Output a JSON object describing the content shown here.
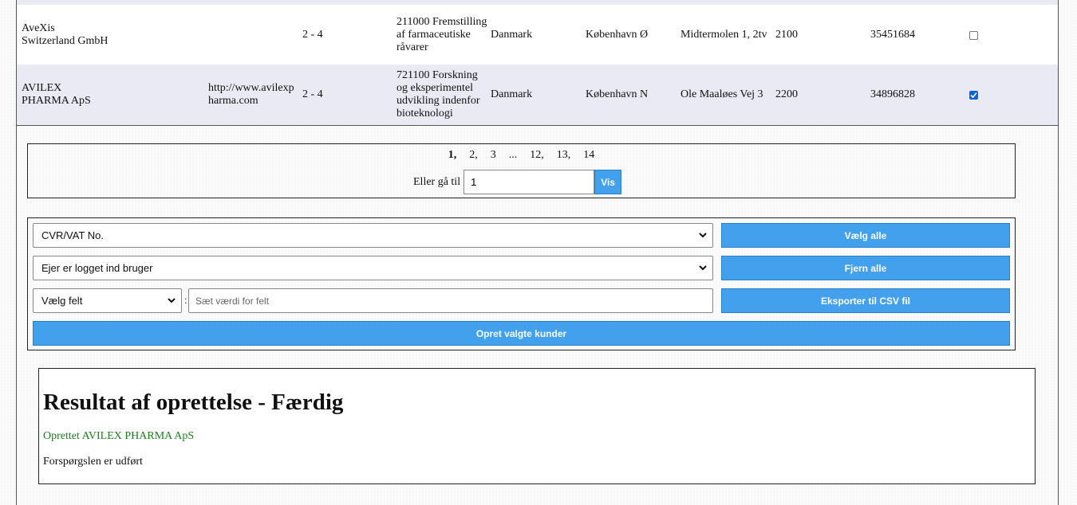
{
  "rows": [
    {
      "name": "AveXis Switzerland GmbH",
      "website": "",
      "employees": "2 - 4",
      "industry": "211000 Fremstilling af farmaceutiske råvarer",
      "country": "Danmark",
      "city": "København Ø",
      "address": "Midtermolen 1, 2tv",
      "zip": "2100",
      "cvr": "35451684",
      "checked": false
    },
    {
      "name": "AVILEX PHARMA ApS",
      "website": "http://www.avilexpharma.com",
      "employees": "2 - 4",
      "industry": "721100 Forskning og eksperimentel udvikling indenfor bioteknologi",
      "country": "Danmark",
      "city": "København N",
      "address": "Ole Maaløes Vej 3",
      "zip": "2200",
      "cvr": "34896828",
      "checked": true
    }
  ],
  "pagination": {
    "pages": [
      "1,",
      "2,",
      "3",
      "...",
      "12,",
      "13,",
      "14"
    ],
    "current": "1,",
    "goto_label": "Eller gå til",
    "goto_value": "1",
    "vis_label": "Vis"
  },
  "form": {
    "field_select": "CVR/VAT No.",
    "owner_select": "Ejer er logget ind bruger",
    "felt_select": "Vælg felt",
    "colon": ":",
    "value_placeholder": "Sæt værdi for felt",
    "select_all_label": "Vælg alle",
    "remove_all_label": "Fjern alle",
    "export_label": "Eksporter til CSV fil",
    "create_label": "Opret valgte kunder"
  },
  "result": {
    "title": "Resultat af oprettelse - Færdig",
    "created_text": "Oprettet AVILEX PHARMA ApS",
    "done_text": "Forspørgslen er udført"
  },
  "colors": {
    "button_blue": "#42a0ec",
    "row_alt": "#e9eaf3",
    "success_green": "#1a7f1a",
    "checkbox_checked": "#0b62d6"
  }
}
